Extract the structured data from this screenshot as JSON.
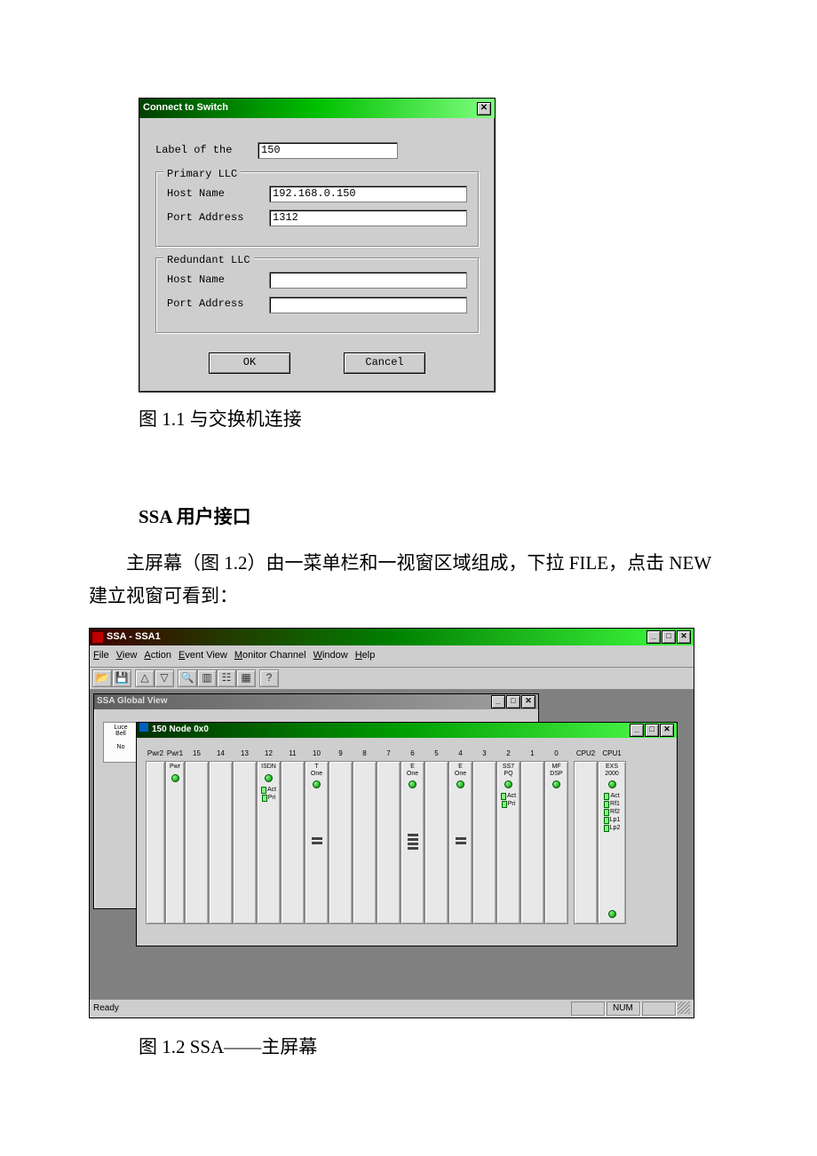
{
  "dialog": {
    "title": "Connect to Switch",
    "close_glyph": "✕",
    "label_of_the": "Label of the",
    "label_value": "150",
    "primary": {
      "legend": "Primary LLC",
      "host_label": "Host Name",
      "host_value": "192.168.0.150",
      "port_label": "Port Address",
      "port_value": "1312"
    },
    "redundant": {
      "legend": "Redundant LLC",
      "host_label": "Host Name",
      "host_value": "",
      "port_label": "Port Address",
      "port_value": ""
    },
    "ok": "OK",
    "cancel": "Cancel"
  },
  "caption1": "图 1.1 与交换机连接",
  "heading1": "SSA 用户接口",
  "paragraph1": "主屏幕（图 1.2）由一菜单栏和一视窗区域组成，下拉 FILE，点击 NEW 建立视窗可看到：",
  "caption2": "图 1.2 SSA——主屏幕",
  "app": {
    "title": "SSA - SSA1",
    "menus": {
      "file": "File",
      "view": "View",
      "action": "Action",
      "eventview": "Event View",
      "monitorchannel": "Monitor Channel",
      "window": "Window",
      "help": "Help"
    },
    "toolbar_glyphs": {
      "open": "📂",
      "save": "💾",
      "up": "△",
      "down": "▽",
      "find": "🔍",
      "col": "▥",
      "tree": "☷",
      "grid": "▦",
      "help": "?"
    },
    "winbtns": {
      "min": "_",
      "max": "□",
      "close": "✕"
    },
    "global": {
      "title": "SSA Global View",
      "small_switch": "Luce\nBell\n\nNo"
    },
    "node": {
      "title": "150  Node 0x0",
      "headers": {
        "pwr2": "Pwr2",
        "pwr1": "Pwr1",
        "s15": "15",
        "s14": "14",
        "s13": "13",
        "s12": "12",
        "s11": "11",
        "s10": "10",
        "s9": "9",
        "s8": "8",
        "s7": "7",
        "s6": "6",
        "s5": "5",
        "s4": "4",
        "s3": "3",
        "s2": "2",
        "s1": "1",
        "s0": "0",
        "cpu2": "CPU2",
        "cpu1": "CPU1"
      },
      "cards": {
        "pwr": "Pwr",
        "isdn": "ISDN",
        "act": "Act",
        "pri": "Pri",
        "tone": "T\nOne",
        "eone": "E\nOne",
        "ss7pq": "SS7\nPQ",
        "mfdsp": "MF\nDSP",
        "exs2000": "EXS\n2000",
        "rf1": "Rf1",
        "rf2": "Rf2",
        "lp1": "Lp1",
        "lp2": "Lp2"
      }
    },
    "status": {
      "ready": "Ready",
      "num": "NUM"
    }
  }
}
